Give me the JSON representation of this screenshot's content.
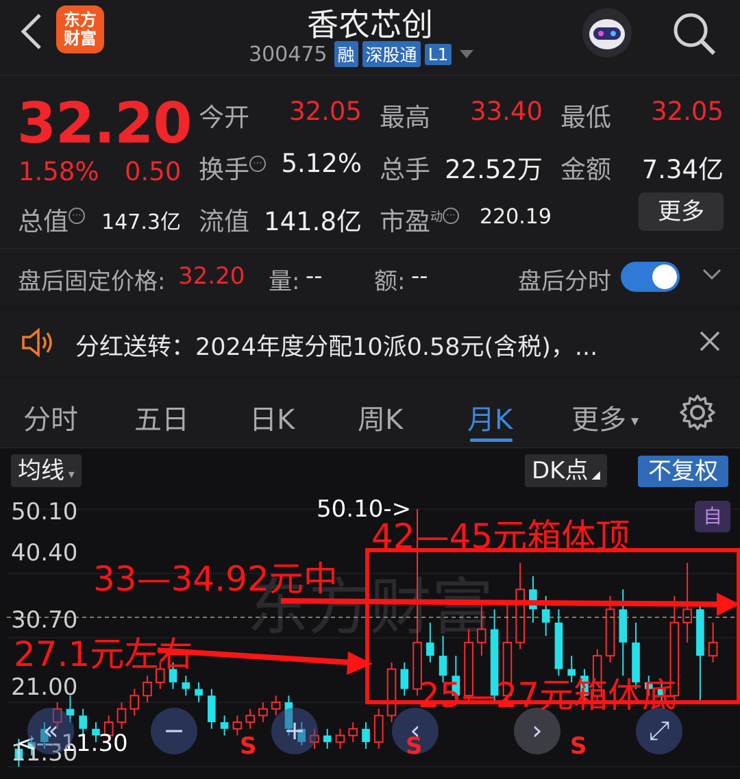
{
  "header": {
    "title": "香农芯创",
    "code": "300475",
    "tags": [
      "融",
      "深股通",
      "L1"
    ],
    "logo_lines": [
      "东方",
      "财富"
    ]
  },
  "quote": {
    "price": "32.20",
    "pct": "1.58%",
    "chg": "0.50",
    "row1": [
      {
        "label": "今开",
        "value": "32.05"
      },
      {
        "label": "最高",
        "value": "33.40"
      },
      {
        "label": "最低",
        "value": "32.05"
      }
    ],
    "row2": [
      {
        "label": "换手",
        "value": "5.12%"
      },
      {
        "label": "总手",
        "value": "22.52万"
      },
      {
        "label": "金额",
        "value": "7.34亿"
      }
    ],
    "row3": [
      {
        "label": "总值",
        "value": "147.3亿"
      },
      {
        "label": "流值",
        "value": "141.8亿"
      },
      {
        "label": "市盈",
        "sup": "动",
        "value": "220.19"
      }
    ],
    "more": "更多",
    "info_glyph": "⋯"
  },
  "after_hours": {
    "label": "盘后固定价格:",
    "price": "32.20",
    "vol_label": "量:",
    "vol": "--",
    "amt_label": "额:",
    "amt": "--",
    "toggle_label": "盘后分时"
  },
  "notice": {
    "text": "分红送转：2024年度分配10派0.58元(含税)，..."
  },
  "tabs": [
    "分时",
    "五日",
    "日K",
    "周K",
    "月K",
    "更多"
  ],
  "active_tab": "月K",
  "chart_toolbar": {
    "ma": "均线",
    "dk": "DK点",
    "adjust": "不复权",
    "zi": "自"
  },
  "chart_data": {
    "type": "candlestick",
    "y_ticks": [
      "50.10",
      "40.40",
      "30.70",
      "21.00",
      "11.30"
    ],
    "high_marker": "50.10->",
    "low_marker": "<---11.30",
    "last_close": 30.7,
    "candles": [
      [
        14,
        12.5,
        15.5,
        11.3
      ],
      [
        15,
        14,
        16,
        13
      ],
      [
        17,
        15,
        18,
        14
      ],
      [
        18,
        20,
        21,
        17
      ],
      [
        20,
        19,
        22,
        18
      ],
      [
        19,
        17,
        20,
        16
      ],
      [
        17,
        16,
        18,
        15
      ],
      [
        16,
        18,
        19,
        15
      ],
      [
        18,
        20,
        21,
        17
      ],
      [
        20,
        22,
        23,
        19
      ],
      [
        22,
        24,
        25,
        21
      ],
      [
        24,
        26,
        27.1,
        23
      ],
      [
        26,
        24,
        27,
        23
      ],
      [
        24,
        23,
        25,
        22
      ],
      [
        23,
        22,
        24,
        21
      ],
      [
        22,
        18,
        23,
        17
      ],
      [
        18,
        17,
        19,
        16
      ],
      [
        17,
        18,
        19,
        16
      ],
      [
        18,
        19,
        20,
        17
      ],
      [
        19,
        20,
        21,
        18
      ],
      [
        20,
        21,
        22,
        19
      ],
      [
        21,
        17,
        22,
        16
      ],
      [
        17,
        15,
        18,
        14.5
      ],
      [
        15,
        16,
        17,
        14
      ],
      [
        16,
        15,
        17,
        14
      ],
      [
        15,
        16,
        17,
        14
      ],
      [
        16,
        17,
        18,
        15
      ],
      [
        17,
        15,
        18,
        14
      ],
      [
        15,
        19,
        20,
        14
      ],
      [
        19,
        26,
        27,
        18
      ],
      [
        26,
        23,
        27,
        22
      ],
      [
        23,
        30,
        50.1,
        22
      ],
      [
        30,
        28,
        33,
        27
      ],
      [
        28,
        25,
        31,
        24
      ],
      [
        25,
        22,
        28,
        21
      ],
      [
        22,
        30,
        32,
        21
      ],
      [
        30,
        32,
        36,
        28
      ],
      [
        32,
        22,
        35,
        21
      ],
      [
        22,
        30,
        36,
        21
      ],
      [
        30,
        38,
        42,
        29
      ],
      [
        38,
        35,
        40,
        33
      ],
      [
        35,
        33,
        37,
        31
      ],
      [
        33,
        26,
        35,
        25
      ],
      [
        26,
        25,
        28,
        24
      ],
      [
        25,
        22,
        26,
        21
      ],
      [
        22,
        28,
        29,
        21
      ],
      [
        28,
        35,
        37,
        27
      ],
      [
        35,
        30,
        38,
        25
      ],
      [
        30,
        24,
        33,
        23
      ],
      [
        24,
        23,
        25,
        22
      ],
      [
        23,
        22,
        24,
        21
      ],
      [
        22,
        33,
        37,
        21
      ],
      [
        33,
        35,
        42,
        30
      ],
      [
        35,
        28,
        36,
        21
      ],
      [
        28,
        30,
        33,
        27
      ]
    ],
    "annotations": {
      "box_top": "42—45元箱体顶",
      "box_mid": "33—34.92元中",
      "support": "27.1元左右",
      "box_bottom": "25—27元箱体底"
    },
    "signals": [
      "S",
      "S",
      "S"
    ]
  }
}
